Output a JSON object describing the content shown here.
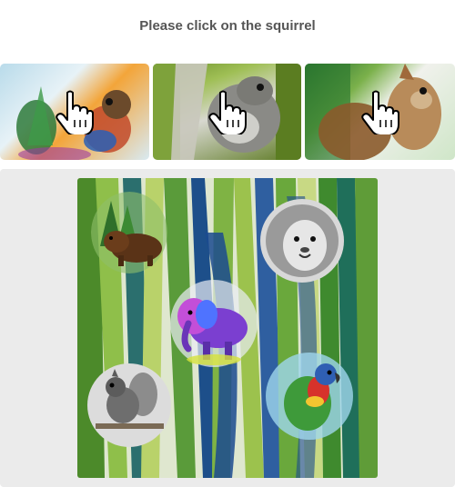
{
  "prompt": {
    "text": "Please click on the squirrel"
  },
  "examples": [
    {
      "icon": "squirrel-watercolor-image"
    },
    {
      "icon": "squirrel-sketch-image"
    },
    {
      "icon": "squirrel-closeup-image"
    }
  ],
  "canvas": {
    "background": "green-blue-leaves-watercolor",
    "animals": [
      {
        "name": "bear"
      },
      {
        "name": "lion"
      },
      {
        "name": "elephant"
      },
      {
        "name": "squirrel"
      },
      {
        "name": "parrot"
      }
    ]
  },
  "colors": {
    "prompt_text": "#555555",
    "panel_background": "#ebebeb"
  }
}
